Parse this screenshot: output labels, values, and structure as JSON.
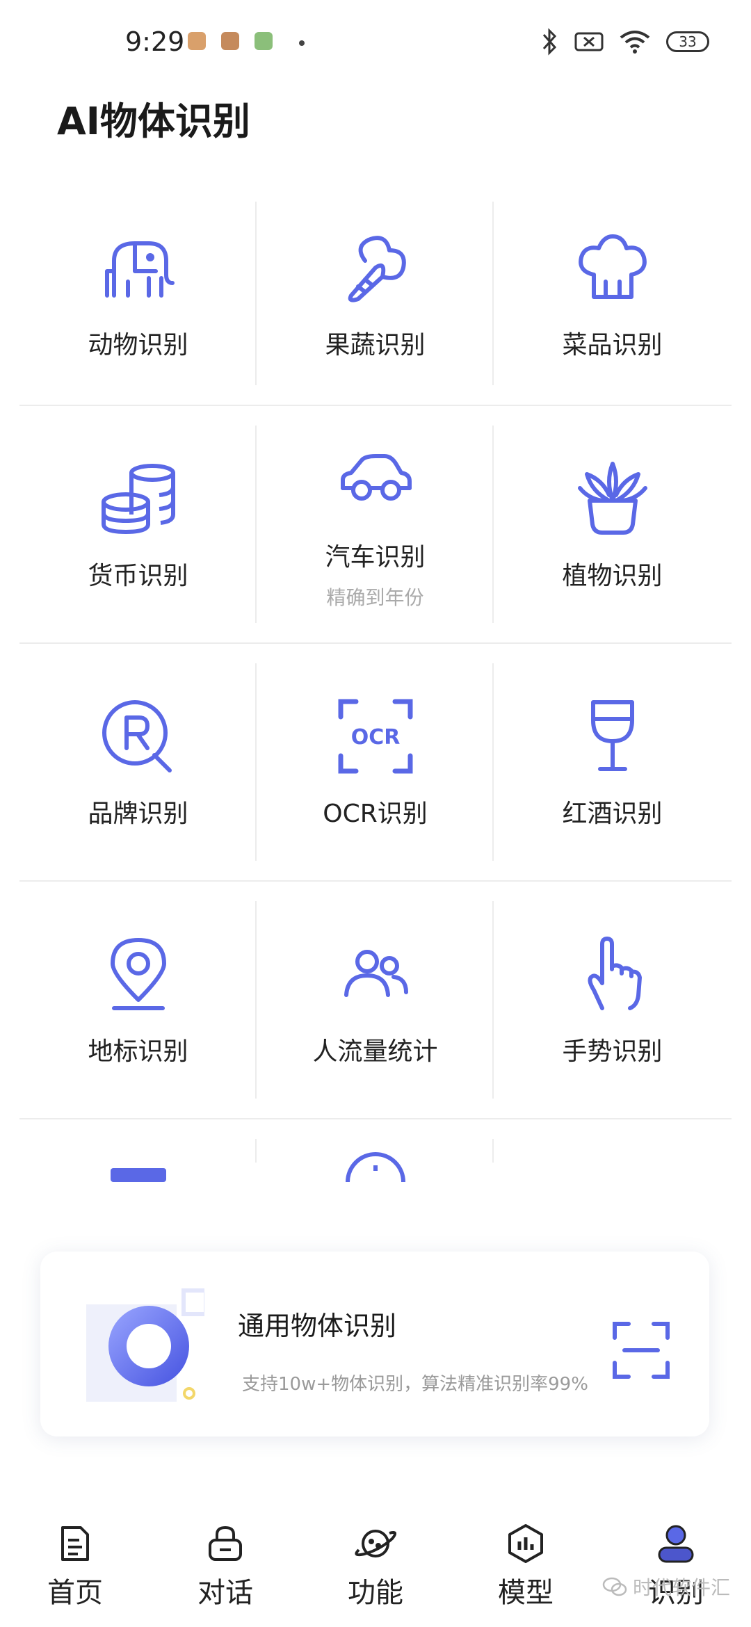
{
  "status_bar": {
    "time": "9:29",
    "battery": "33",
    "notification_colors": [
      "#d9a06b",
      "#c58a5c",
      "#8bbf7a"
    ]
  },
  "page_title": "AI物体识别",
  "accent_color": "#5a68e6",
  "grid": {
    "rows": [
      [
        {
          "label": "动物识别",
          "icon": "elephant-icon"
        },
        {
          "label": "果蔬识别",
          "icon": "vegetable-icon"
        },
        {
          "label": "菜品识别",
          "icon": "chef-hat-icon"
        }
      ],
      [
        {
          "label": "货币识别",
          "icon": "coins-icon"
        },
        {
          "label": "汽车识别",
          "sublabel": "精确到年份",
          "icon": "car-icon"
        },
        {
          "label": "植物识别",
          "icon": "potted-plant-icon"
        }
      ],
      [
        {
          "label": "品牌识别",
          "icon": "brand-r-icon"
        },
        {
          "label": "OCR识别",
          "icon": "ocr-icon"
        },
        {
          "label": "红酒识别",
          "icon": "wine-glass-icon"
        }
      ],
      [
        {
          "label": "地标识别",
          "icon": "location-pin-icon"
        },
        {
          "label": "人流量统计",
          "icon": "people-icon"
        },
        {
          "label": "手势识别",
          "icon": "hand-pointer-icon"
        }
      ]
    ]
  },
  "feature_card": {
    "title": "通用物体识别",
    "subtitle": "支持10w+物体识别，算法精准识别率99%"
  },
  "bottom_nav": [
    {
      "label": "首页",
      "icon": "document-icon",
      "active": false
    },
    {
      "label": "对话",
      "icon": "chat-lock-icon",
      "active": false
    },
    {
      "label": "功能",
      "icon": "planet-icon",
      "active": false
    },
    {
      "label": "模型",
      "icon": "hexagon-chart-icon",
      "active": false
    },
    {
      "label": "识别",
      "icon": "user-icon",
      "active": true
    }
  ],
  "watermark": "时代软件汇"
}
